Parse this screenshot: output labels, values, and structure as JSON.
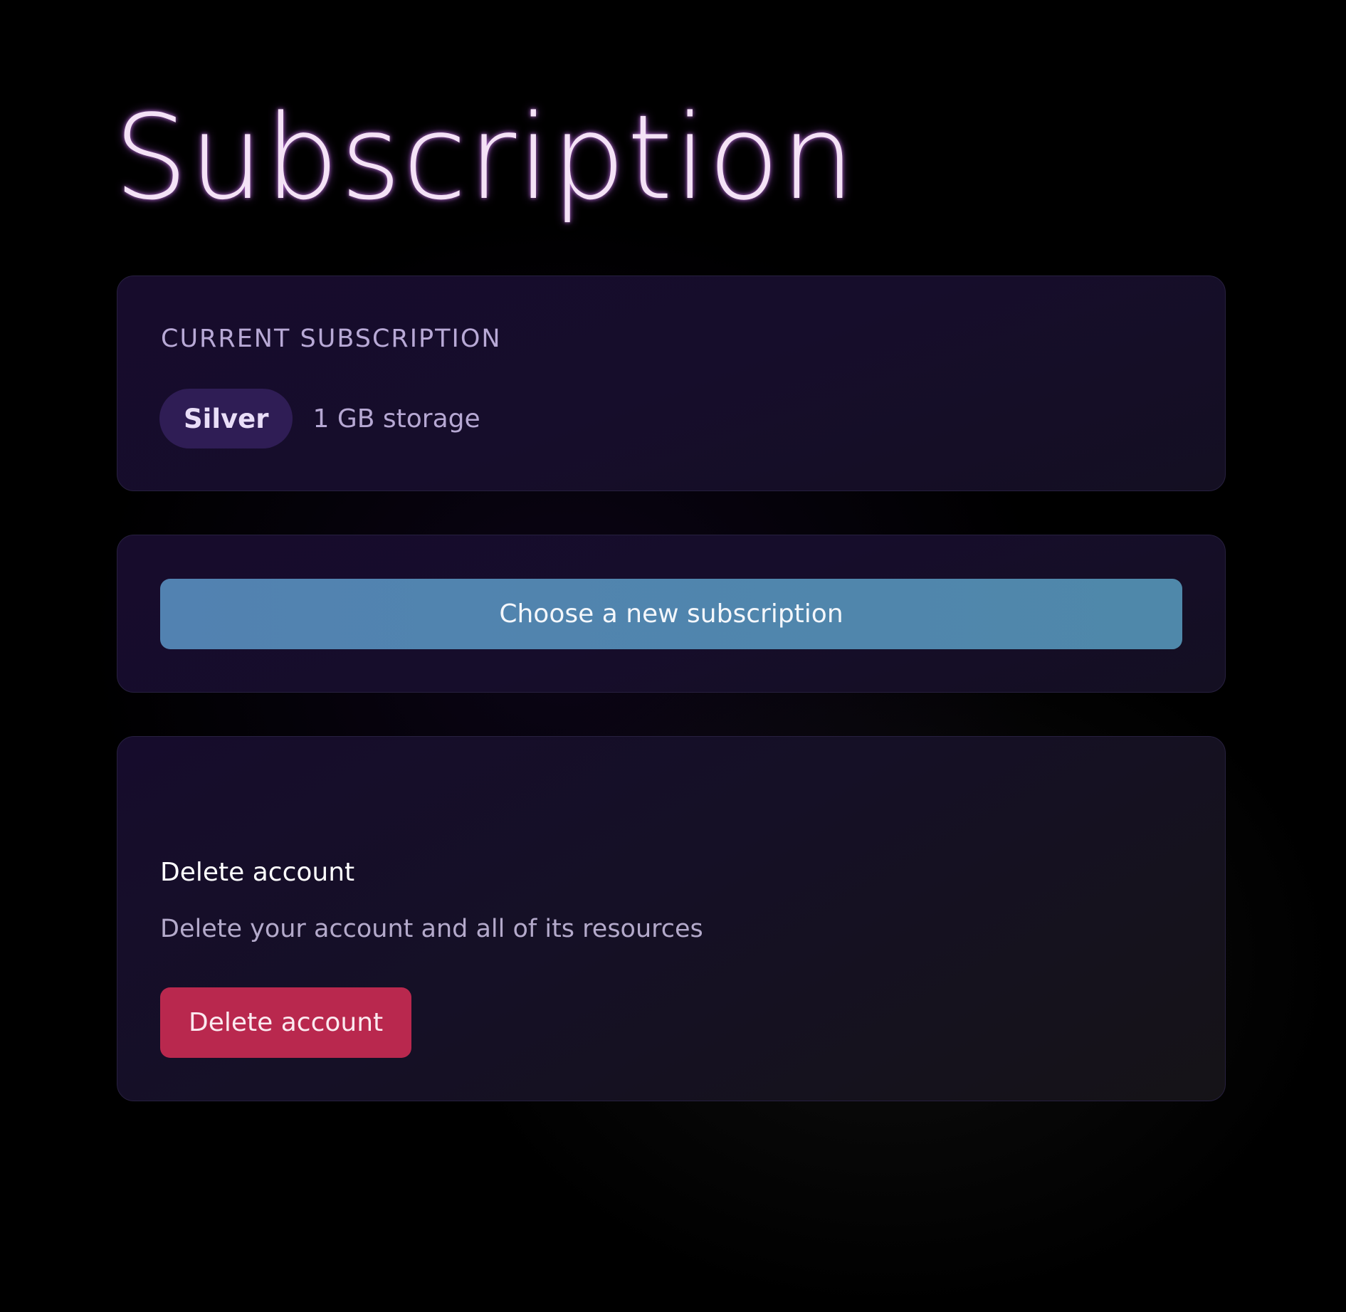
{
  "page": {
    "title": "Subscription"
  },
  "current_subscription": {
    "label": "CURRENT SUBSCRIPTION",
    "plan_name": "Silver",
    "plan_detail": "1 GB storage"
  },
  "choose": {
    "button_label": "Choose a new subscription"
  },
  "delete_account": {
    "heading": "Delete account",
    "description": "Delete your account and all of its resources",
    "button_label": "Delete account"
  },
  "colors": {
    "background": "#000000",
    "card": "#170c2c",
    "plan_pill": "#2f1d55",
    "primary_button": "#5282b1",
    "danger_button": "#b9284e",
    "title_glow": "#c878e6"
  }
}
